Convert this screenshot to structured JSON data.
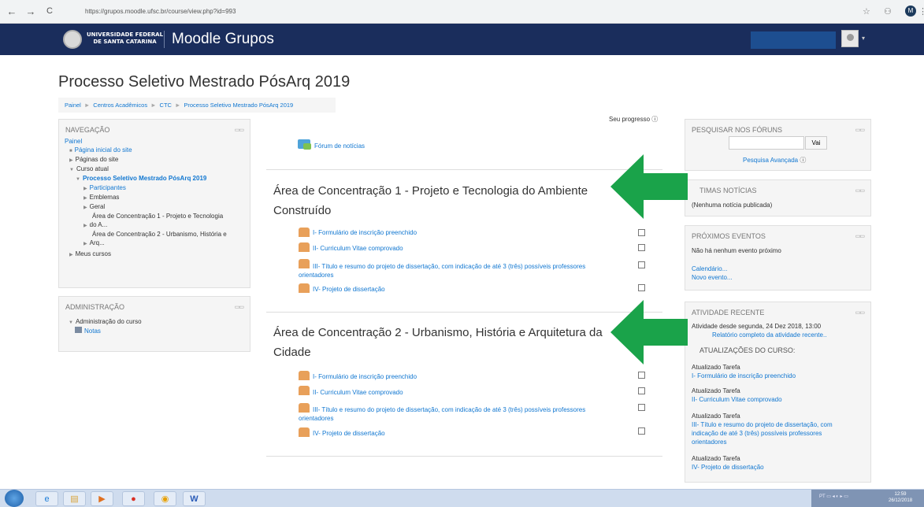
{
  "browser": {
    "url": "https://grupos.moodle.ufsc.br/course/view.php?id=993",
    "back": "←",
    "forward": "→",
    "reload": "C",
    "profile_initial": "M"
  },
  "header": {
    "logo_line1": "UNIVERSIDADE FEDERAL",
    "logo_line2": "DE SANTA CATARINA",
    "site_name": "Moodle Grupos"
  },
  "page": {
    "title": "Processo Seletivo Mestrado PósArq 2019",
    "breadcrumb": [
      "Painel",
      "Centros Acadêmicos",
      "CTC",
      "Processo Seletivo Mestrado PósArq 2019"
    ]
  },
  "navigation": {
    "title": "NAVEGAÇÃO",
    "items": [
      "Painel",
      "Página inicial do site",
      "Páginas do site",
      "Curso atual",
      "Processo Seletivo Mestrado PósArq 2019",
      "Participantes",
      "Emblemas",
      "Geral",
      "Área de Concentração 1 - Projeto e Tecnologia",
      "do A...",
      "Área de Concentração 2 - Urbanismo, História e",
      "Arq...",
      "Meus cursos"
    ]
  },
  "administration": {
    "title": "ADMINISTRAÇÃO",
    "course_admin": "Administração do curso",
    "grades": "Notas"
  },
  "main": {
    "progress_label": "Seu progresso",
    "news_forum": "Fórum de notícias",
    "sections": [
      {
        "title_line1": "Área de Concentração 1 - Projeto e Tecnologia do Ambiente",
        "title_line2": "Construído",
        "activities": [
          "I- Formulário de inscrição preenchido",
          "II- Curriculum Vitae comprovado",
          "III- Título e resumo do projeto de dissertação, com indicação de até 3 (três) possíveis professores",
          "orientadores",
          "IV- Projeto de dissertação"
        ]
      },
      {
        "title_line1": "Área de Concentração 2 - Urbanismo, História e Arquitetura da",
        "title_line2": "Cidade",
        "activities": [
          "I- Formulário de inscrição preenchido",
          "II- Curriculum Vitae comprovado",
          "III- Título e resumo do projeto de dissertação, com indicação de até 3 (três) possíveis professores",
          "orientadores",
          "IV- Projeto de dissertação"
        ]
      }
    ]
  },
  "search_forums": {
    "title": "PESQUISAR NOS FÓRUNS",
    "button": "Vai",
    "advanced": "Pesquisa Avançada"
  },
  "latest_news": {
    "title": "ÚLTIMAS NOTÍCIAS",
    "visible_title": "TIMAS NOTÍCIAS",
    "empty": "(Nenhuma notícia publicada)"
  },
  "upcoming_events": {
    "title": "PRÓXIMOS EVENTOS",
    "empty": "Não há nenhum evento próximo",
    "calendar": "Calendário...",
    "new_event": "Novo evento..."
  },
  "recent_activity": {
    "title": "ATIVIDADE RECENTE",
    "visible_title": "ATIVIDADE RECENTE",
    "since": "Atividade desde segunda, 24 Dez 2018, 13:00",
    "full_report": "Relatório completo da atividade recente..",
    "updates_heading": "ATUALIZAÇÕES DO CURSO:",
    "updates": [
      {
        "label": "Atualizado Tarefa",
        "link": "I- Formulário de inscrição preenchido"
      },
      {
        "label": "Atualizado Tarefa",
        "link": "II- Curriculum Vitae comprovado"
      },
      {
        "label": "Atualizado Tarefa",
        "link_lines": [
          "III- Título e resumo do projeto de dissertação, com",
          "indicação de até 3 (três) possíveis professores",
          "orientadores"
        ]
      },
      {
        "label": "Atualizado Tarefa",
        "link": "IV- Projeto de dissertação"
      }
    ]
  },
  "taskbar": {
    "language": "PT",
    "time": "12:59",
    "date": "26/12/2018"
  },
  "colors": {
    "header_bg": "#1a2d5c",
    "link": "#1177d1",
    "arrow": "#1aa34a"
  }
}
